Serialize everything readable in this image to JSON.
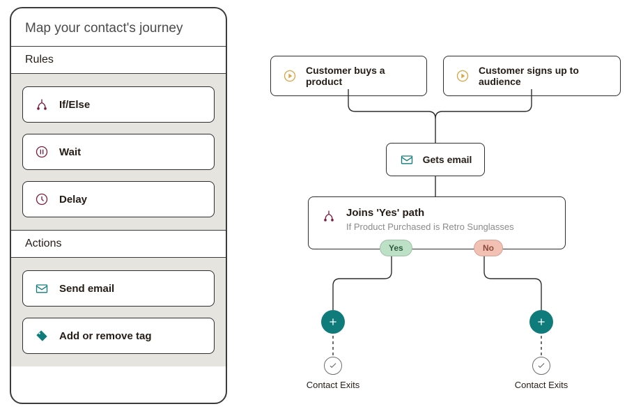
{
  "panel": {
    "title": "Map your contact's journey",
    "sections": {
      "rules": {
        "header": "Rules",
        "items": [
          {
            "icon": "branch-icon",
            "label": "If/Else"
          },
          {
            "icon": "pause-icon",
            "label": "Wait"
          },
          {
            "icon": "clock-icon",
            "label": "Delay"
          }
        ]
      },
      "actions": {
        "header": "Actions",
        "items": [
          {
            "icon": "mail-icon",
            "label": "Send email"
          },
          {
            "icon": "tag-icon",
            "label": "Add or remove tag"
          }
        ]
      }
    }
  },
  "flow": {
    "triggers": [
      {
        "icon": "trigger-icon",
        "label": "Customer buys a product"
      },
      {
        "icon": "trigger-icon",
        "label": "Customer signs up to audience"
      }
    ],
    "email_node": {
      "icon": "mail-icon",
      "label": "Gets email"
    },
    "condition": {
      "icon": "branch-icon",
      "title": "Joins 'Yes' path",
      "subtitle": "If Product Purchased is Retro Sunglasses",
      "pills": {
        "yes": "Yes",
        "no": "No"
      }
    },
    "exit_label": "Contact Exits"
  },
  "colors": {
    "accent_teal": "#0f7b7b",
    "trigger_ring": "#d9a441",
    "icon_maroon": "#7b1d3f",
    "pill_yes": "#bde1c6",
    "pill_no": "#f3c1b3"
  }
}
